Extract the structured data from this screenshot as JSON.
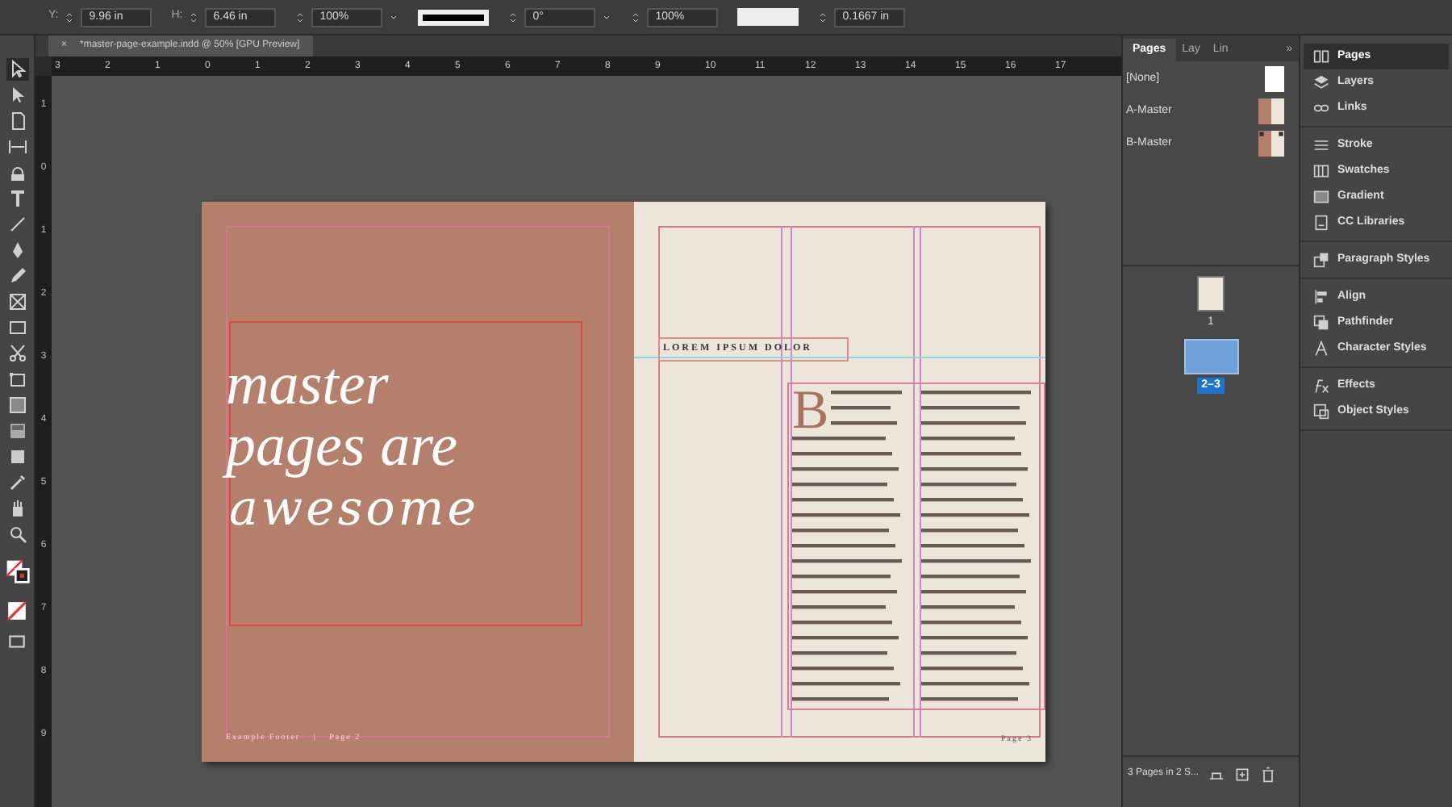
{
  "control_bar": {
    "fields": [
      {
        "label": "Y:",
        "value": "9.96 in"
      },
      {
        "label": "H:",
        "value": "6.46 in"
      },
      {
        "value": "100%",
        "dropdown": true
      },
      {
        "value": "0°",
        "dropdown": true
      },
      {
        "value": "100%",
        "dropdown": false
      },
      {
        "value": "0.1667 in",
        "dropdown": false
      }
    ]
  },
  "document_tab": {
    "close": "×",
    "title": "*master-page-example.indd @ 50% [GPU Preview]"
  },
  "ruler": {
    "top_labels": [
      "3",
      "2",
      "1",
      "0",
      "1",
      "2",
      "3",
      "4",
      "5",
      "6",
      "7",
      "8",
      "9",
      "10",
      "11",
      "12",
      "13",
      "14",
      "15",
      "16",
      "17"
    ],
    "side_labels": [
      "1",
      "0",
      "1",
      "2",
      "3",
      "4",
      "5",
      "6",
      "7",
      "8",
      "9"
    ]
  },
  "tools": [
    {
      "kind": "selection",
      "selected": true
    },
    {
      "kind": "direct",
      "selected": false
    },
    {
      "kind": "page",
      "selected": false
    },
    {
      "kind": "gap",
      "selected": false
    },
    {
      "kind": "content",
      "selected": false
    },
    {
      "kind": "type",
      "selected": false
    },
    {
      "kind": "line",
      "selected": false
    },
    {
      "kind": "pen",
      "selected": false
    },
    {
      "kind": "pencil",
      "selected": false
    },
    {
      "kind": "frame",
      "selected": false
    },
    {
      "kind": "rect",
      "selected": false
    },
    {
      "kind": "scissors",
      "selected": false
    },
    {
      "kind": "transform",
      "selected": false
    },
    {
      "kind": "gradient",
      "selected": false
    },
    {
      "kind": "feather",
      "selected": false
    },
    {
      "kind": "note",
      "selected": false
    },
    {
      "kind": "eyedropper",
      "selected": false
    },
    {
      "kind": "hand",
      "selected": false
    },
    {
      "kind": "zoom",
      "selected": false
    }
  ],
  "spread": {
    "left_page": {
      "title_lines": [
        "master",
        "pages are"
      ],
      "script_line": "awesome",
      "footer": [
        "Example Footer",
        "|",
        "Page 2"
      ]
    },
    "right_page": {
      "heading": "LOREM IPSUM DOLOR",
      "drop_cap": "B",
      "footer": "Page 3"
    }
  },
  "pages_panel": {
    "tabs": [
      {
        "label": "Pages",
        "selected": true
      },
      {
        "label": "Lay",
        "selected": false
      },
      {
        "label": "Lin",
        "selected": false
      }
    ],
    "more": "»",
    "masters": [
      {
        "name": "[None]",
        "kind": "none"
      },
      {
        "name": "A-Master",
        "kind": "a"
      },
      {
        "name": "B-Master",
        "kind": "b"
      }
    ],
    "pages": [
      {
        "label": "1",
        "kind": "single",
        "selected": false
      },
      {
        "label": "2–3",
        "kind": "spread",
        "selected": true
      }
    ],
    "status": "3 Pages in 2 S..."
  },
  "side_panel": {
    "groups": [
      [
        {
          "label": "Pages",
          "kind": "pages",
          "selected": true
        },
        {
          "label": "Layers",
          "kind": "layers",
          "selected": false
        },
        {
          "label": "Links",
          "kind": "links",
          "selected": false
        }
      ],
      [
        {
          "label": "Stroke",
          "kind": "stroke",
          "selected": false
        },
        {
          "label": "Swatches",
          "kind": "swatches",
          "selected": false
        },
        {
          "label": "Gradient",
          "kind": "gradient",
          "selected": false
        },
        {
          "label": "CC Libraries",
          "kind": "libraries",
          "selected": false
        }
      ],
      [
        {
          "label": "Paragraph Styles",
          "kind": "para",
          "selected": false
        }
      ],
      [
        {
          "label": "Align",
          "kind": "align",
          "selected": false
        },
        {
          "label": "Pathfinder",
          "kind": "pathfinder",
          "selected": false
        },
        {
          "label": "Character Styles",
          "kind": "char",
          "selected": false
        }
      ],
      [
        {
          "label": "Effects",
          "kind": "effects",
          "selected": false
        },
        {
          "label": "Object Styles",
          "kind": "objstyles",
          "selected": false
        }
      ]
    ]
  }
}
